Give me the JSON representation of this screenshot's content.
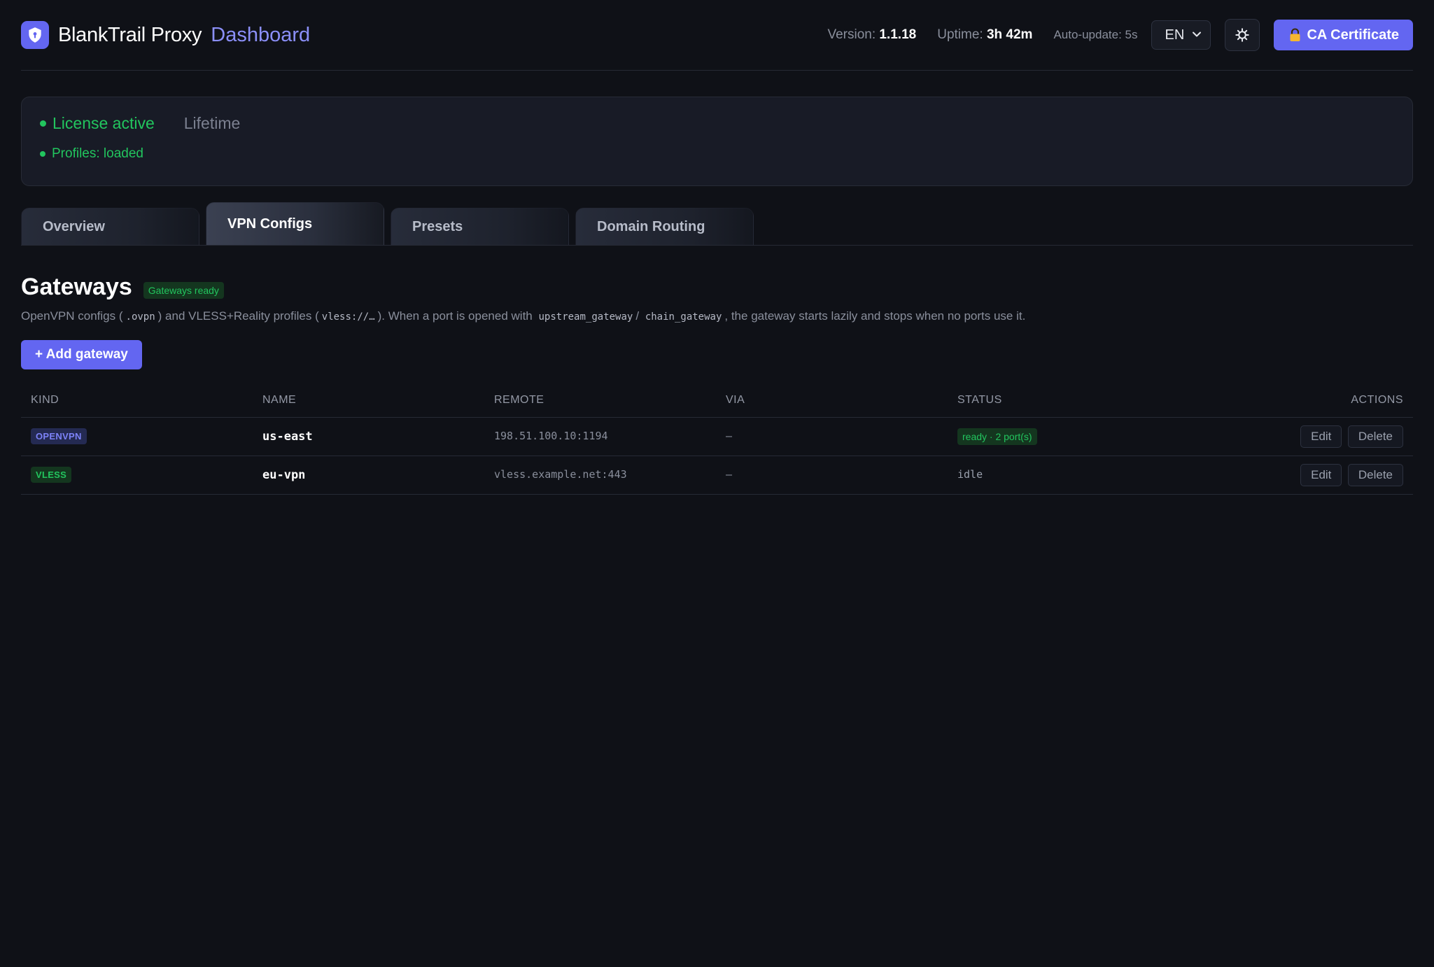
{
  "header": {
    "app_name": "BlankTrail Proxy",
    "section": "Dashboard",
    "version_label": "Version:",
    "version": "1.1.18",
    "uptime_label": "Uptime:",
    "uptime": "3h 42m",
    "auto_update": "Auto-update: 5s",
    "language": "EN",
    "ca_button": "CA Certificate"
  },
  "license": {
    "status": "License active",
    "plan": "Lifetime",
    "profiles": "Profiles: loaded"
  },
  "tabs": [
    {
      "label": "Overview",
      "active": false
    },
    {
      "label": "VPN Configs",
      "active": true
    },
    {
      "label": "Presets",
      "active": false
    },
    {
      "label": "Domain Routing",
      "active": false
    }
  ],
  "gateways": {
    "title": "Gateways",
    "badge": "Gateways ready",
    "desc": {
      "p1": "OpenVPN configs (",
      "c1": ".ovpn",
      "p2": ") and VLESS+Reality profiles (",
      "c2": "vless://…",
      "p3": "). When a port is opened with",
      "c3": "upstream_gateway",
      "p4": "/",
      "c4": "chain_gateway",
      "p5": ", the gateway starts lazily and stops when no ports use it."
    },
    "add_button": "+ Add gateway",
    "columns": {
      "kind": "KIND",
      "name": "NAME",
      "remote": "REMOTE",
      "via": "VIA",
      "status": "STATUS",
      "actions": "ACTIONS"
    },
    "rows": [
      {
        "kind": "OPENVPN",
        "name": "us-east",
        "remote": "198.51.100.10:1194",
        "via": "—",
        "status": "ready · 2 port(s)",
        "edit": "Edit",
        "delete": "Delete"
      },
      {
        "kind": "VLESS",
        "name": "eu-vpn",
        "remote": "vless.example.net:443",
        "via": "—",
        "status": "idle",
        "edit": "Edit",
        "delete": "Delete"
      }
    ]
  },
  "colors": {
    "accent": "#6366f1",
    "success": "#22c55e",
    "background": "#0f1117",
    "card": "#181b26"
  },
  "icons": {
    "logo": "shield-icon",
    "language": "chevron-down-icon",
    "settings": "gear-icon",
    "ca": "lock-icon"
  }
}
